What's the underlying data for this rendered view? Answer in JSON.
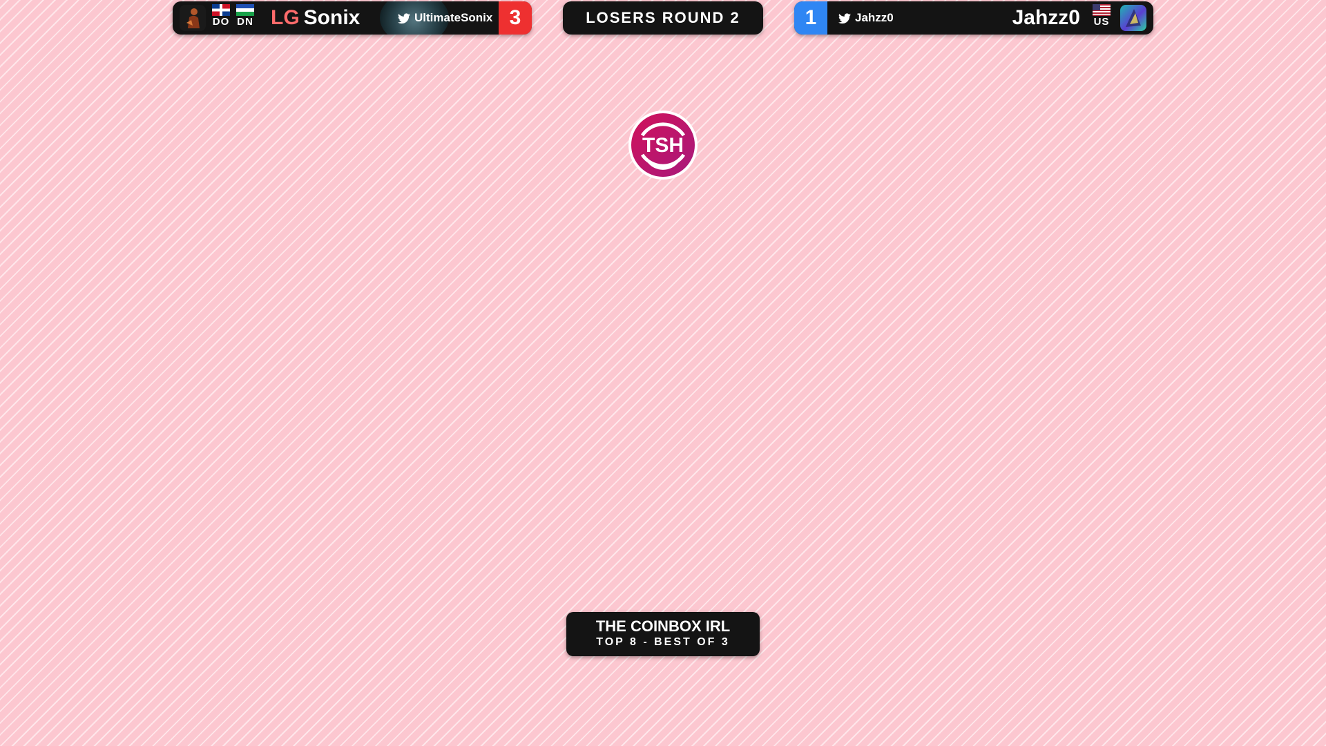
{
  "player1": {
    "sponsor": "LG",
    "name": "Sonix",
    "twitter": "UltimateSonix",
    "score": "3",
    "flags": [
      {
        "code": "DO",
        "icon": "dominican-republic-flag-icon"
      },
      {
        "code": "DN",
        "icon": "state-flag-icon"
      }
    ],
    "accent_color": "#ee3030"
  },
  "player2": {
    "name": "Jahzz0",
    "twitter": "Jahzz0",
    "score": "1",
    "flags": [
      {
        "code": "US",
        "icon": "united-states-flag-icon"
      }
    ],
    "accent_color": "#2f86f3"
  },
  "match": {
    "round": "LOSERS ROUND 2"
  },
  "logo": {
    "text": "TSH",
    "color": "#c4125f"
  },
  "event": {
    "name": "THE COINBOX IRL",
    "phase": "TOP 8 - BEST OF 3"
  }
}
